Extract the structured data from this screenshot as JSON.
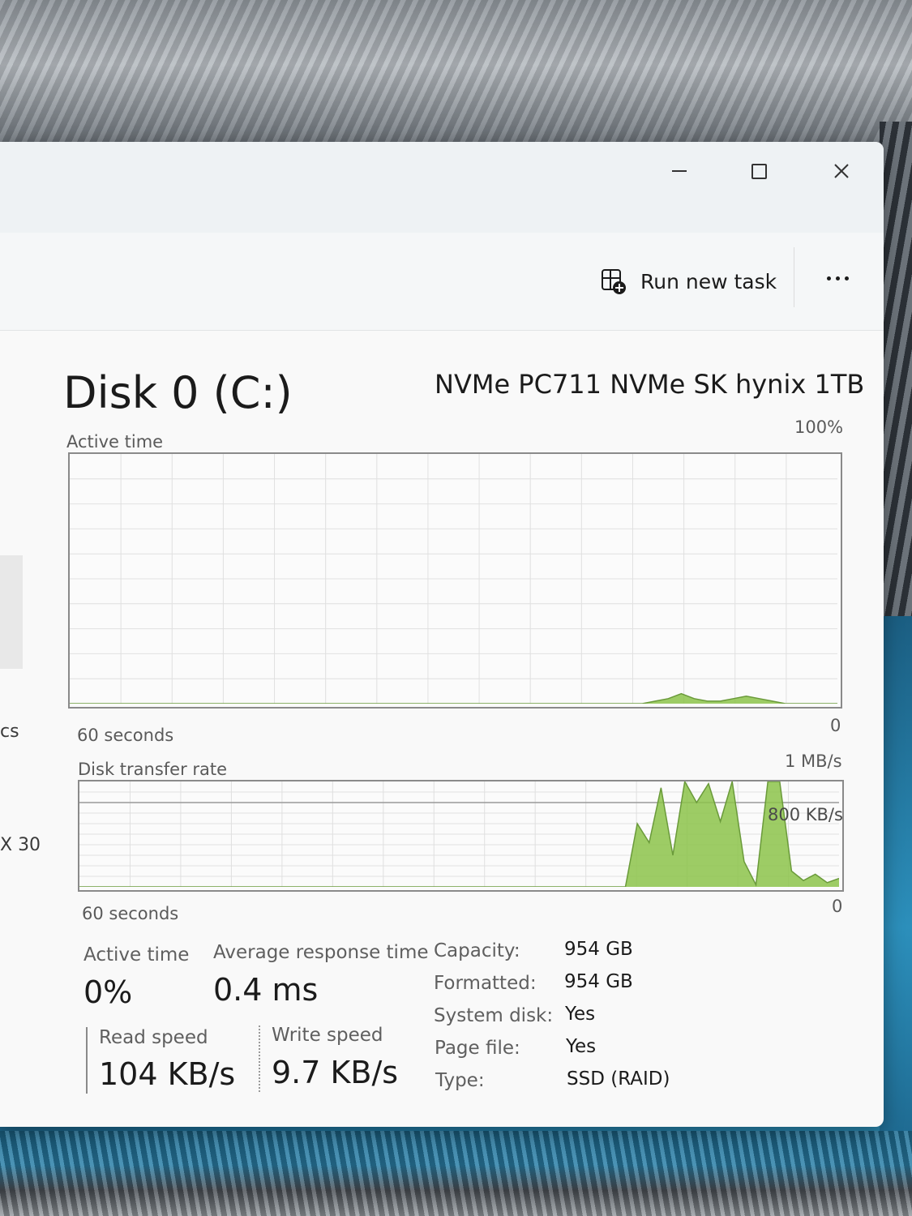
{
  "window": {
    "command_bar": {
      "run_new_task_label": "Run new task",
      "more_icon": "ellipsis-icon",
      "run_task_icon": "run-task-icon"
    },
    "caption_buttons": [
      "minimize-icon",
      "maximize-icon",
      "close-icon"
    ]
  },
  "sidebar": {
    "fragment_1": "cs",
    "fragment_2": "X 30"
  },
  "disk": {
    "title": "Disk 0 (C:)",
    "model": "NVMe PC711 NVMe SK hynix 1TB"
  },
  "active_time_graph": {
    "label": "Active time",
    "max_label": "100%",
    "min_label": "0",
    "time_label": "60 seconds",
    "accent": "#8cc34a",
    "values_percent": [
      0,
      0,
      0,
      0,
      0,
      0,
      0,
      0,
      0,
      0,
      0,
      0,
      0,
      0,
      0,
      0,
      0,
      0,
      0,
      0,
      0,
      0,
      0,
      0,
      0,
      0,
      0,
      0,
      0,
      0,
      0,
      0,
      0,
      0,
      0,
      0,
      0,
      0,
      0,
      0,
      0,
      0,
      0,
      0,
      0,
      1,
      2,
      4,
      2,
      1,
      1,
      2,
      3,
      2,
      1,
      0,
      0,
      0,
      0,
      0
    ]
  },
  "transfer_graph": {
    "label": "Disk transfer rate",
    "max_label": "1 MB/s",
    "mid_label": "800 KB/s",
    "min_label": "0",
    "time_label": "60 seconds",
    "accent": "#8cc34a",
    "values_kbs": [
      0,
      0,
      0,
      0,
      0,
      0,
      0,
      0,
      0,
      0,
      0,
      0,
      0,
      0,
      0,
      0,
      0,
      0,
      0,
      0,
      0,
      0,
      0,
      0,
      0,
      0,
      0,
      0,
      0,
      0,
      0,
      0,
      0,
      0,
      0,
      0,
      0,
      0,
      0,
      0,
      0,
      0,
      0,
      0,
      0,
      0,
      0,
      600,
      420,
      940,
      300,
      1000,
      800,
      980,
      620,
      1000,
      240,
      20,
      1000,
      1000,
      150,
      60,
      120,
      40,
      80
    ]
  },
  "stats": {
    "active_time_label": "Active time",
    "active_time_value": "0%",
    "avg_response_label": "Average response time",
    "avg_response_value": "0.4 ms",
    "read_speed_label": "Read speed",
    "read_speed_value": "104 KB/s",
    "write_speed_label": "Write speed",
    "write_speed_value": "9.7 KB/s"
  },
  "properties": [
    {
      "label": "Capacity:",
      "value": "954 GB"
    },
    {
      "label": "Formatted:",
      "value": "954 GB"
    },
    {
      "label": "System disk:",
      "value": "Yes"
    },
    {
      "label": "Page file:",
      "value": "Yes"
    },
    {
      "label": "Type:",
      "value": "SSD (RAID)"
    }
  ]
}
